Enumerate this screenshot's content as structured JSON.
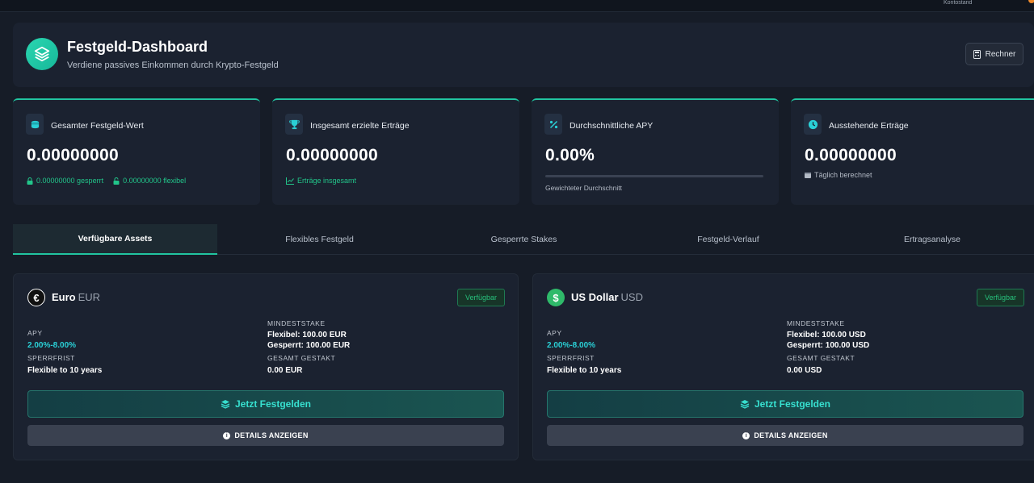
{
  "topbar": {
    "account_label": "Kontostand"
  },
  "header": {
    "title": "Festgeld-Dashboard",
    "subtitle": "Verdiene passives Einkommen durch Krypto-Festgeld",
    "calculator_label": "Rechner"
  },
  "stats": [
    {
      "label": "Gesamter Festgeld-Wert",
      "value": "0.00000000",
      "locked": "0.00000000 gesperrt",
      "flexible": "0.00000000 flexibel"
    },
    {
      "label": "Insgesamt erzielte Erträge",
      "value": "0.00000000",
      "note": "Erträge insgesamt"
    },
    {
      "label": "Durchschnittliche APY",
      "value": "0.00%",
      "progress": 0,
      "note": "Gewichteter Durchschnitt"
    },
    {
      "label": "Ausstehende Erträge",
      "value": "0.00000000",
      "note": "Täglich berechnet"
    }
  ],
  "tabs": [
    {
      "label": "Verfügbare Assets",
      "active": true
    },
    {
      "label": "Flexibles Festgeld",
      "active": false
    },
    {
      "label": "Gesperrte Stakes",
      "active": false
    },
    {
      "label": "Festgeld-Verlauf",
      "active": false
    },
    {
      "label": "Ertragsanalyse",
      "active": false
    }
  ],
  "assets": [
    {
      "name": "Euro",
      "code": "EUR",
      "symbol": "€",
      "status": "Verfügbar",
      "apy_label": "APY",
      "apy": "2.00%-8.00%",
      "lock_label": "SPERRFRIST",
      "lock": "Flexible to 10 years",
      "min_label": "MINDESTSTAKE",
      "min_flexible": "Flexibel: 100.00 EUR",
      "min_locked": "Gesperrt: 100.00 EUR",
      "total_label": "GESAMT GESTAKT",
      "total": "0.00 EUR",
      "cta": "Jetzt Festgelden",
      "details": "DETAILS ANZEIGEN"
    },
    {
      "name": "US Dollar",
      "code": "USD",
      "symbol": "$",
      "status": "Verfügbar",
      "apy_label": "APY",
      "apy": "2.00%-8.00%",
      "lock_label": "SPERRFRIST",
      "lock": "Flexible to 10 years",
      "min_label": "MINDESTSTAKE",
      "min_flexible": "Flexibel: 100.00 USD",
      "min_locked": "Gesperrt: 100.00 USD",
      "total_label": "GESAMT GESTAKT",
      "total": "0.00 USD",
      "cta": "Jetzt Festgelden",
      "details": "DETAILS ANZEIGEN"
    }
  ],
  "colors": {
    "accent": "#21c4a0",
    "positive": "#22c58a",
    "cyan": "#2ad0d6",
    "background": "#161c27",
    "card": "#1b2230"
  }
}
